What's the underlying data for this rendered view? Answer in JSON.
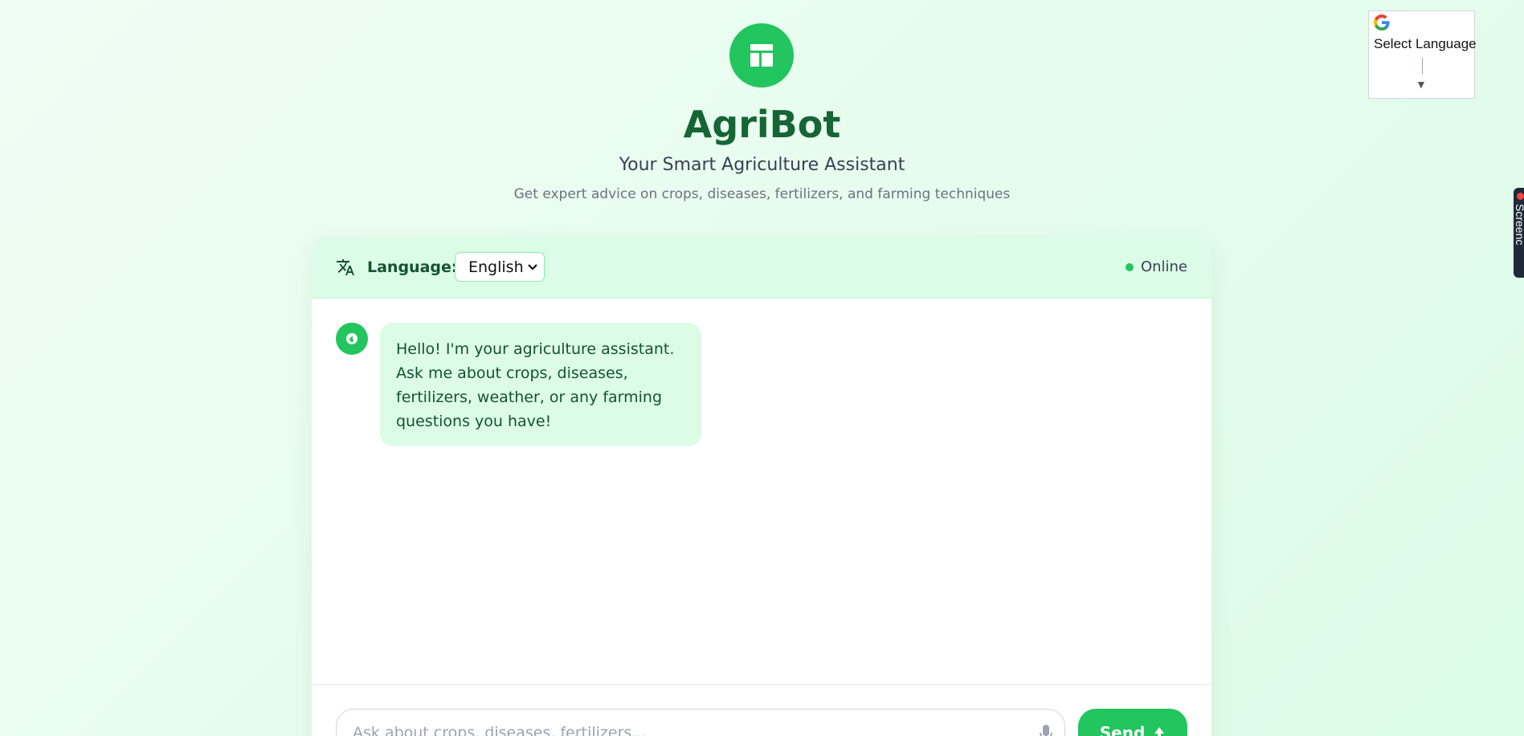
{
  "app": {
    "title": "AgriBot",
    "subtitle": "Your Smart Agriculture Assistant",
    "tagline": "Get expert advice on crops, diseases, fertilizers, and farming techniques"
  },
  "translate_widget": {
    "label": "Select Language",
    "icon": "google-g-icon"
  },
  "side_tab": {
    "label": "Screenc"
  },
  "chat": {
    "language_label": "Language:",
    "language_selected": "English",
    "status": "Online",
    "messages": [
      {
        "sender": "bot",
        "text": "Hello! I'm your agriculture assistant. Ask me about crops, diseases, fertilizers, weather, or any farming questions you have!"
      }
    ],
    "input_placeholder": "Ask about crops, diseases, fertilizers...",
    "send_label": "Send"
  },
  "colors": {
    "brand": "#22c55e",
    "title": "#166534",
    "bubble": "#dcfce7",
    "background": "#f0fdf4"
  }
}
